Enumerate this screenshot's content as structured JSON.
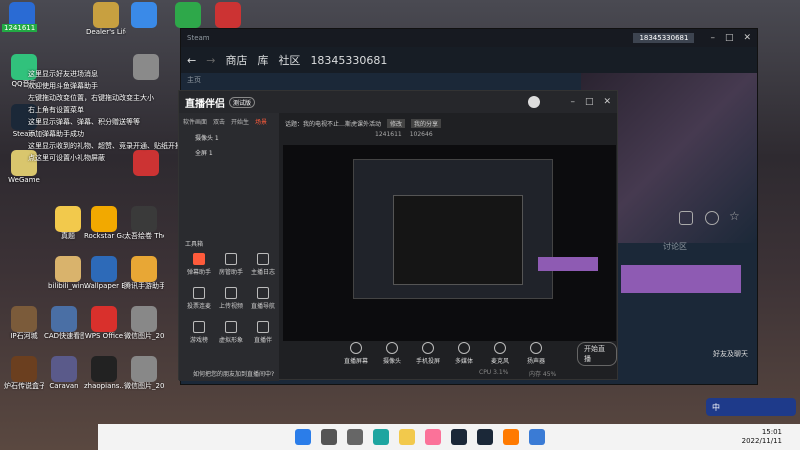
{
  "desktop": {
    "top_badge": "1241611",
    "icons": [
      {
        "label": "",
        "color": "#2a6bd4"
      },
      {
        "label": "Dealer's Life",
        "color": "#c8a040"
      },
      {
        "label": "",
        "color": "#3a8ae8"
      },
      {
        "label": "",
        "color": "#2ea84a"
      },
      {
        "label": "",
        "color": "#cc3333"
      },
      {
        "label": "QQ音乐",
        "color": "#31c27c"
      },
      {
        "label": "",
        "color": "#8a8a8a"
      },
      {
        "label": "Steam",
        "color": "#1b2838"
      },
      {
        "label": "WeGame",
        "color": "#d9c66d"
      },
      {
        "label": "",
        "color": "#cc3333"
      },
      {
        "label": "真题",
        "color": "#f2c94c"
      },
      {
        "label": "Rockstar Games...",
        "color": "#f2a900"
      },
      {
        "label": "太吾绘卷 The Scroll Of T...",
        "color": "#3a3a3a"
      },
      {
        "label": "bilibili_win...",
        "color": "#d9b36c"
      },
      {
        "label": "Wallpaper Engine: ...",
        "color": "#2d6ab8"
      },
      {
        "label": "腾讯手游助手",
        "color": "#e8a735"
      },
      {
        "label": "IP石河城",
        "color": "#7b5b3a"
      },
      {
        "label": "CAD快速看图",
        "color": "#4a6fa5"
      },
      {
        "label": "WPS Office",
        "color": "#d9302c"
      },
      {
        "label": "微信图片_20220...",
        "color": "#888888"
      },
      {
        "label": "炉石传说盒子",
        "color": "#6b3f1f"
      },
      {
        "label": "Caravan",
        "color": "#5a5a8a"
      },
      {
        "label": "zhaopians...",
        "color": "#222222"
      },
      {
        "label": "微信图片_20220...",
        "color": "#888888"
      }
    ],
    "notification_lines": [
      "这里显示好友进场消息",
      "欢迎使用斗鱼弹幕助手",
      "左键拖动改变位置，右键拖动改变主大小",
      "右上角有设置菜单",
      "这里显示弹幕、弹幕、积分赠送等等",
      "添加弹幕助手成功",
      "这里显示收到的礼物、超赞、竞录开通、贴纸开播等",
      "点这里可设置小礼物屏蔽"
    ]
  },
  "steam": {
    "title": "Steam",
    "nav": [
      "商店",
      "库",
      "社区",
      "18345330681"
    ],
    "home_label": "主页",
    "account": "18345330681",
    "discussion_tab": "讨论区",
    "friends_label": "好友及聊天"
  },
  "streamer": {
    "brand": "直播伴侣",
    "version": "测试版",
    "tabs": [
      "软件画面",
      "双击",
      "开始生",
      "场景"
    ],
    "scene_1": "摄像头 1",
    "scene_2": "全屏 1",
    "topic_label": "话题：我的电视不止…斯虎课外活动",
    "topic_btn": "修改",
    "topic_btn2": "我的分享",
    "live_id": "1241611",
    "views": "102646",
    "toolbox_title": "工具箱",
    "tools": [
      {
        "label": "弹幕助手",
        "active": true
      },
      {
        "label": "房管助手"
      },
      {
        "label": "主播日志"
      },
      {
        "label": "投票连麦"
      },
      {
        "label": "上传视频"
      },
      {
        "label": "直播导航"
      },
      {
        "label": "游戏榜"
      },
      {
        "label": "虚拟形象"
      },
      {
        "label": "直播伴"
      }
    ],
    "controls": [
      "直播屏幕",
      "摄像头",
      "手机投屏",
      "多媒体",
      "麦克风",
      "扬声器"
    ],
    "start_button": "开始直播",
    "bottom_hint": "如何把您的朋友加到直播间中?",
    "cpu_label": "CPU 3.1%",
    "mem_label": "内存 45%"
  },
  "taskbar": {
    "time": "15:01",
    "date": "2022/11/11",
    "ime": "中",
    "icons": [
      "windows",
      "search",
      "taskview",
      "edge",
      "explorer",
      "bilibili",
      "steam-dark",
      "steam",
      "douyu",
      "store"
    ]
  }
}
